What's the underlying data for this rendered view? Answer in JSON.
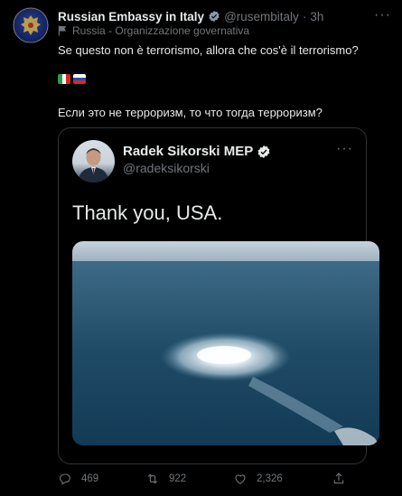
{
  "tweet": {
    "author_name": "Russian Embassy in Italy",
    "author_handle": "@rusembitaly",
    "time": "3h",
    "label": "Russia - Organizzazione governativa",
    "text_it": "Se questo non è terrorismo, allora che cos'è il terrorismo?",
    "text_ru": "Если это не терроризм, то что тогда терроризм?",
    "flags": [
      "italy-flag",
      "russia-flag"
    ]
  },
  "quoted": {
    "author_name": "Radek Sikorski MEP",
    "author_handle": "@radeksikorski",
    "text": "Thank you, USA."
  },
  "actions": {
    "replies": "469",
    "retweets": "922",
    "likes": "2,326"
  },
  "colors": {
    "background": "#000000",
    "text": "#e7e9ea",
    "muted": "#71767b",
    "border": "#2f3336",
    "verified": "#e7e9ea"
  }
}
